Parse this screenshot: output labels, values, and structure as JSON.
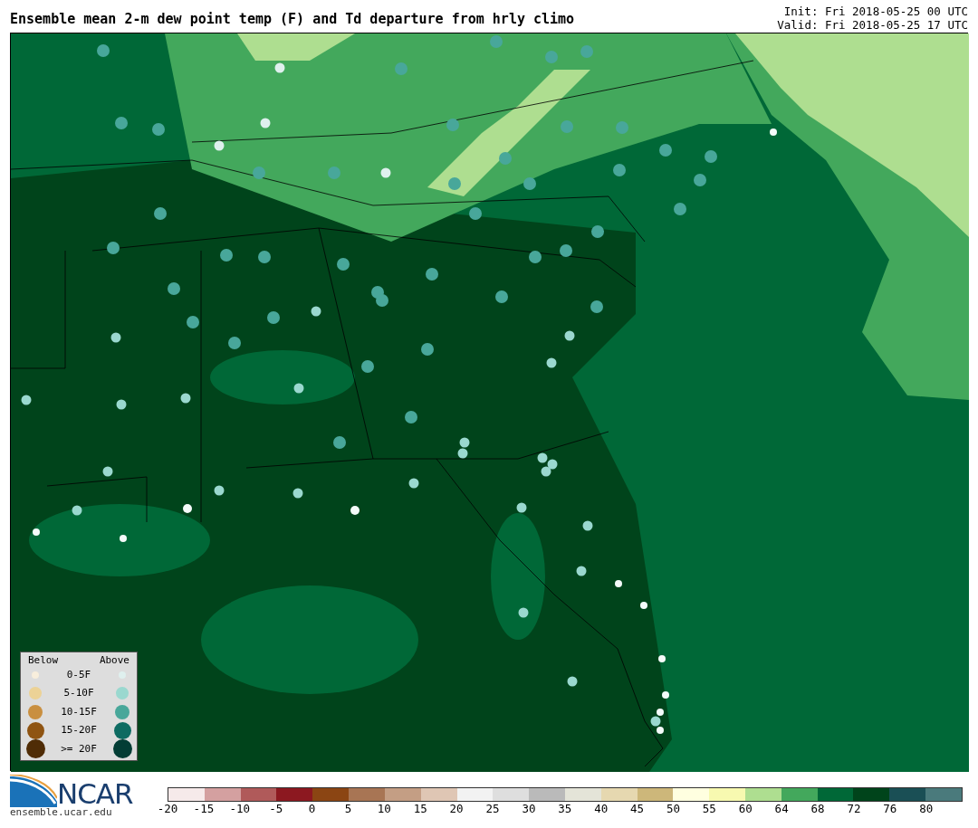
{
  "title": "Ensemble mean 2-m dew point temp (F) and Td departure from hrly climo",
  "init": "Init: Fri 2018-05-25 00 UTC",
  "valid": "Valid: Fri 2018-05-25 17 UTC",
  "legend": {
    "headers": [
      "Below",
      "Above"
    ],
    "rows": [
      {
        "label": "0-5F",
        "below": {
          "color": "#f8eedc"
        },
        "above": {
          "color": "#dff0ee"
        }
      },
      {
        "label": "5-10F",
        "below": {
          "color": "#ecd296"
        },
        "above": {
          "color": "#9ad8cf"
        }
      },
      {
        "label": "10-15F",
        "below": {
          "color": "#c98f40"
        },
        "above": {
          "color": "#48a79a"
        }
      },
      {
        "label": "15-20F",
        "below": {
          "color": "#8f5412"
        },
        "above": {
          "color": "#0d6b62"
        }
      },
      {
        "label": ">= 20F",
        "below": {
          "color": "#4f2c06"
        },
        "above": {
          "color": "#033d35"
        }
      }
    ]
  },
  "colorbar": {
    "segments": [
      {
        "color": "#f6eaea"
      },
      {
        "color": "#d4a0a0"
      },
      {
        "color": "#b05a5a"
      },
      {
        "color": "#8c1820"
      },
      {
        "color": "#8b4513"
      },
      {
        "color": "#a87554"
      },
      {
        "color": "#c49e84"
      },
      {
        "color": "#dfc6b4"
      },
      {
        "color": "#f2f2f2"
      },
      {
        "color": "#dedede"
      },
      {
        "color": "#bababa"
      },
      {
        "color": "#e4e4d8"
      },
      {
        "color": "#e6d8b0"
      },
      {
        "color": "#cdb77a"
      },
      {
        "color": "#ffffe0"
      },
      {
        "color": "#f7f9b0"
      },
      {
        "color": "#aede90"
      },
      {
        "color": "#43a85c"
      },
      {
        "color": "#006837"
      },
      {
        "color": "#00441b"
      },
      {
        "color": "#1a4f55"
      },
      {
        "color": "#4a7a7c"
      }
    ],
    "labels": [
      "-20",
      "-15",
      "-10",
      "-5",
      "0",
      "5",
      "10",
      "15",
      "20",
      "25",
      "30",
      "35",
      "40",
      "45",
      "50",
      "55",
      "60",
      "64",
      "68",
      "72",
      "76",
      "80"
    ]
  },
  "logo": {
    "text": "NCAR",
    "url": "ensemble.ucar.edu"
  }
}
